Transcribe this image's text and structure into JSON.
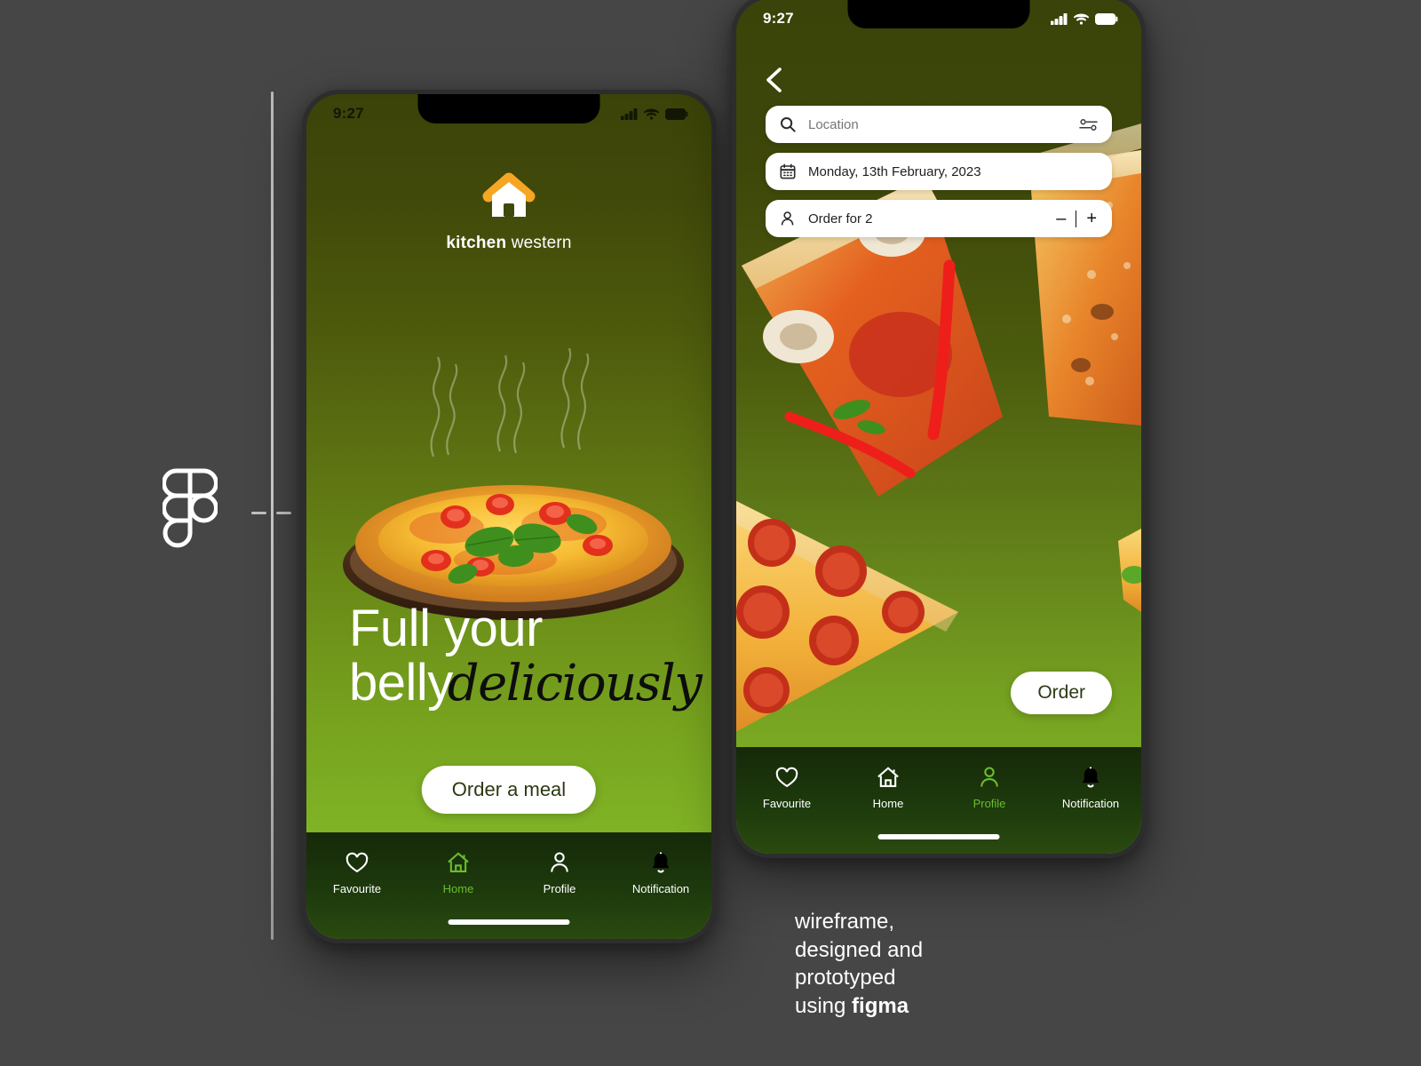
{
  "page": {
    "background_color": "#464646",
    "accent_green": "#6cbd2d",
    "brand_orange": "#f5a623"
  },
  "figma_logo": {
    "icon": "figma-logo-icon"
  },
  "guide": {
    "icon": "vertical-guide-line"
  },
  "phone_one": {
    "status_bar": {
      "time": "9:27",
      "cellular": "signal-icon",
      "wifi": "wifi-icon",
      "battery": "battery-icon"
    },
    "logo": {
      "icon": "house-logo-icon",
      "name_bold": "kitchen",
      "name_light": " western"
    },
    "hero": {
      "image": "margherita-pizza-photo",
      "steam": "steam-wisps"
    },
    "headline": {
      "line1": "Full your",
      "line2_regular": "belly",
      "line2_script": "deliciously"
    },
    "cta": {
      "label": "Order a meal"
    },
    "nav": {
      "items": [
        {
          "label": "Favourite",
          "icon": "heart-icon",
          "active": false
        },
        {
          "label": "Home",
          "icon": "home-icon",
          "active": true
        },
        {
          "label": "Profile",
          "icon": "person-icon",
          "active": false
        },
        {
          "label": "Notification",
          "icon": "bell-icon",
          "active": false
        }
      ]
    }
  },
  "phone_two": {
    "status_bar": {
      "time": "9:27",
      "cellular": "signal-icon",
      "wifi": "wifi-icon",
      "battery": "battery-icon"
    },
    "back": {
      "icon": "chevron-left-icon"
    },
    "fields": {
      "location": {
        "placeholder": "Location",
        "value": "",
        "icon": "search-icon",
        "trailing_icon": "filter-sliders-icon"
      },
      "date": {
        "value": "Monday, 13th February, 2023",
        "icon": "calendar-icon"
      },
      "party": {
        "value": "Order for 2",
        "icon": "person-icon",
        "decrement": "–",
        "increment": "+"
      }
    },
    "collage": {
      "image": "pizza-slices-collage"
    },
    "cta": {
      "label": "Order"
    },
    "nav": {
      "items": [
        {
          "label": "Favourite",
          "icon": "heart-icon",
          "active": false
        },
        {
          "label": "Home",
          "icon": "home-icon",
          "active": false
        },
        {
          "label": "Profile",
          "icon": "person-icon",
          "active": true
        },
        {
          "label": "Notification",
          "icon": "bell-icon",
          "active": false
        }
      ]
    }
  },
  "caption": {
    "line1": "wireframe,",
    "line2": "designed and",
    "line3": "prototyped",
    "line4_prefix": "using ",
    "line4_bold": "figma"
  }
}
